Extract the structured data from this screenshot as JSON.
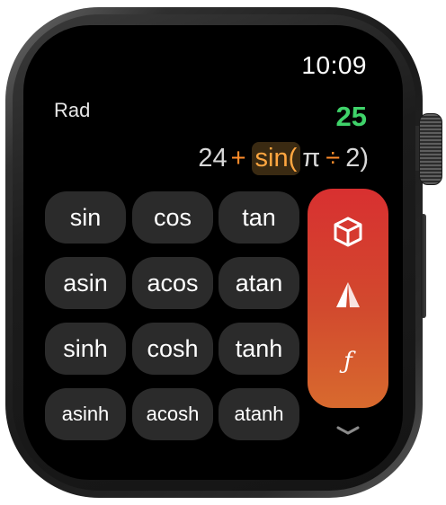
{
  "status": {
    "time": "10:09"
  },
  "calculator": {
    "angle_mode": "Rad",
    "result": "25",
    "expression": {
      "num": "24",
      "plus": "+",
      "func": "sin(",
      "pi": "π",
      "div": "÷",
      "two": "2",
      "close": ")"
    }
  },
  "keys": {
    "row1": [
      "sin",
      "cos",
      "tan"
    ],
    "row2": [
      "asin",
      "acos",
      "atan"
    ],
    "row3": [
      "sinh",
      "cosh",
      "tanh"
    ],
    "row4": [
      "asinh",
      "acosh",
      "atanh"
    ]
  },
  "side_panel": {
    "icons": [
      "cube-icon",
      "prism-icon",
      "function-icon"
    ],
    "function_glyph": "ƒ"
  },
  "more": {
    "icon": "chevron-down-icon"
  },
  "colors": {
    "result": "#3fd36a",
    "operator": "#ff8c2a",
    "panel_top": "#d83030",
    "panel_bottom": "#d86a2e",
    "key_bg": "#2b2b2b"
  }
}
